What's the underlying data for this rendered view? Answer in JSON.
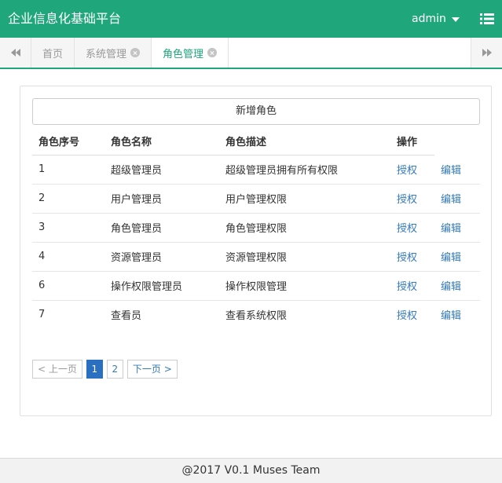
{
  "header": {
    "title": "企业信息化基础平台",
    "user": "admin"
  },
  "tabs": [
    {
      "label": "首页",
      "closable": false,
      "active": false
    },
    {
      "label": "系统管理",
      "closable": true,
      "active": false
    },
    {
      "label": "角色管理",
      "closable": true,
      "active": true
    }
  ],
  "content": {
    "add_button": "新增角色",
    "table": {
      "columns": [
        "角色序号",
        "角色名称",
        "角色描述",
        "操作"
      ],
      "rows": [
        {
          "id": "1",
          "name": "超级管理员",
          "desc": "超级管理员拥有所有权限",
          "grant": "授权",
          "edit": "编辑"
        },
        {
          "id": "2",
          "name": "用户管理员",
          "desc": "用户管理权限",
          "grant": "授权",
          "edit": "编辑"
        },
        {
          "id": "3",
          "name": "角色管理员",
          "desc": "角色管理权限",
          "grant": "授权",
          "edit": "编辑"
        },
        {
          "id": "4",
          "name": "资源管理员",
          "desc": "资源管理权限",
          "grant": "授权",
          "edit": "编辑"
        },
        {
          "id": "6",
          "name": "操作权限管理员",
          "desc": "操作权限管理",
          "grant": "授权",
          "edit": "编辑"
        },
        {
          "id": "7",
          "name": "查看员",
          "desc": "查看系统权限",
          "grant": "授权",
          "edit": "编辑"
        }
      ]
    },
    "pagination": {
      "prev": "< 上一页",
      "pages": [
        "1",
        "2"
      ],
      "current": "1",
      "next": "下一页 >"
    }
  },
  "footer": {
    "text": "@2017 V0.1 Muses Team"
  },
  "colors": {
    "brand": "#1fa67a",
    "link": "#337ab7",
    "active_page": "#2b6fc1"
  }
}
